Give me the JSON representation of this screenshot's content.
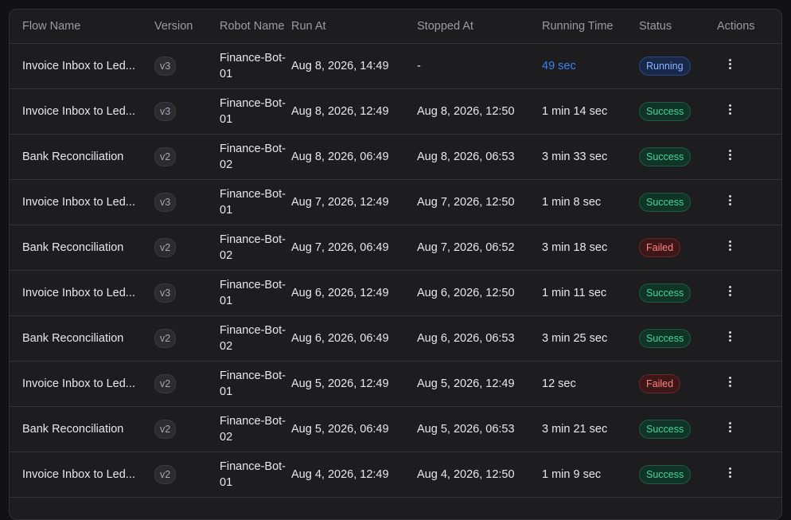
{
  "table": {
    "headers": {
      "flow_name": "Flow Name",
      "version": "Version",
      "robot_name": "Robot Name",
      "run_at": "Run At",
      "stopped_at": "Stopped At",
      "running_time": "Running Time",
      "status": "Status",
      "actions": "Actions"
    },
    "rows": [
      {
        "flow_name": "Invoice Inbox to Led...",
        "version": "v3",
        "robot_name": "Finance-Bot-01",
        "run_at": "Aug 8, 2026, 14:49",
        "stopped_at": "-",
        "running_time": "49 sec",
        "status": "Running"
      },
      {
        "flow_name": "Invoice Inbox to Led...",
        "version": "v3",
        "robot_name": "Finance-Bot-01",
        "run_at": "Aug 8, 2026, 12:49",
        "stopped_at": "Aug 8, 2026, 12:50",
        "running_time": "1 min 14 sec",
        "status": "Success"
      },
      {
        "flow_name": "Bank Reconciliation",
        "version": "v2",
        "robot_name": "Finance-Bot-02",
        "run_at": "Aug 8, 2026, 06:49",
        "stopped_at": "Aug 8, 2026, 06:53",
        "running_time": "3 min 33 sec",
        "status": "Success"
      },
      {
        "flow_name": "Invoice Inbox to Led...",
        "version": "v3",
        "robot_name": "Finance-Bot-01",
        "run_at": "Aug 7, 2026, 12:49",
        "stopped_at": "Aug 7, 2026, 12:50",
        "running_time": "1 min 8 sec",
        "status": "Success"
      },
      {
        "flow_name": "Bank Reconciliation",
        "version": "v2",
        "robot_name": "Finance-Bot-02",
        "run_at": "Aug 7, 2026, 06:49",
        "stopped_at": "Aug 7, 2026, 06:52",
        "running_time": "3 min 18 sec",
        "status": "Failed"
      },
      {
        "flow_name": "Invoice Inbox to Led...",
        "version": "v3",
        "robot_name": "Finance-Bot-01",
        "run_at": "Aug 6, 2026, 12:49",
        "stopped_at": "Aug 6, 2026, 12:50",
        "running_time": "1 min 11 sec",
        "status": "Success"
      },
      {
        "flow_name": "Bank Reconciliation",
        "version": "v2",
        "robot_name": "Finance-Bot-02",
        "run_at": "Aug 6, 2026, 06:49",
        "stopped_at": "Aug 6, 2026, 06:53",
        "running_time": "3 min 25 sec",
        "status": "Success"
      },
      {
        "flow_name": "Invoice Inbox to Led...",
        "version": "v2",
        "robot_name": "Finance-Bot-01",
        "run_at": "Aug 5, 2026, 12:49",
        "stopped_at": "Aug 5, 2026, 12:49",
        "running_time": "12 sec",
        "status": "Failed"
      },
      {
        "flow_name": "Bank Reconciliation",
        "version": "v2",
        "robot_name": "Finance-Bot-02",
        "run_at": "Aug 5, 2026, 06:49",
        "stopped_at": "Aug 5, 2026, 06:53",
        "running_time": "3 min 21 sec",
        "status": "Success"
      },
      {
        "flow_name": "Invoice Inbox to Led...",
        "version": "v2",
        "robot_name": "Finance-Bot-01",
        "run_at": "Aug 4, 2026, 12:49",
        "stopped_at": "Aug 4, 2026, 12:50",
        "running_time": "1 min 9 sec",
        "status": "Success"
      }
    ]
  },
  "icons": {
    "row_actions": "more-vertical-icon"
  },
  "colors": {
    "running": "#3b82f6",
    "success": "#44d69a",
    "failed": "#ff8282",
    "background": "#1d1d20"
  }
}
